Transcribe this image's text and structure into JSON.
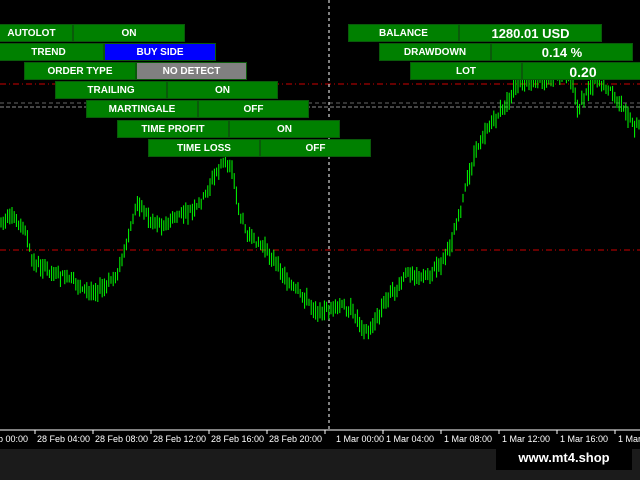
{
  "panel_left": [
    {
      "label": "AUTOLOT",
      "value": "ON",
      "value_style": "green"
    },
    {
      "label": "TREND",
      "value": "BUY SIDE",
      "value_style": "blue"
    },
    {
      "label": "ORDER TYPE",
      "value": "NO DETECT",
      "value_style": "gray"
    },
    {
      "label": "TRAILING",
      "value": "ON",
      "value_style": "green"
    },
    {
      "label": "MARTINGALE",
      "value": "OFF",
      "value_style": "green"
    },
    {
      "label": "TIME PROFIT",
      "value": "ON",
      "value_style": "green"
    },
    {
      "label": "TIME LOSS",
      "value": "OFF",
      "value_style": "green"
    }
  ],
  "panel_right": [
    {
      "label": "BALANCE",
      "value": "1280.01 USD"
    },
    {
      "label": "DRAWDOWN",
      "value": "0.14 %"
    },
    {
      "label": "LOT",
      "value": "0.20"
    }
  ],
  "time_axis": [
    "b 00:00",
    "28 Feb 04:00",
    "28 Feb 08:00",
    "28 Feb 12:00",
    "28 Feb 16:00",
    "28 Feb 20:00",
    "1 Mar 00:00",
    "1 Mar 04:00",
    "1 Mar 08:00",
    "1 Mar 12:00",
    "1 Mar 16:00",
    "1 Mar"
  ],
  "watermark": "www.mt4.shop",
  "colors": {
    "background": "#000000",
    "candles": "#00ff00",
    "button_green": "#008000",
    "button_blue": "#0000ff",
    "button_gray": "#808080",
    "level_line": "#cc0000",
    "period_separator": "#ffffff"
  }
}
